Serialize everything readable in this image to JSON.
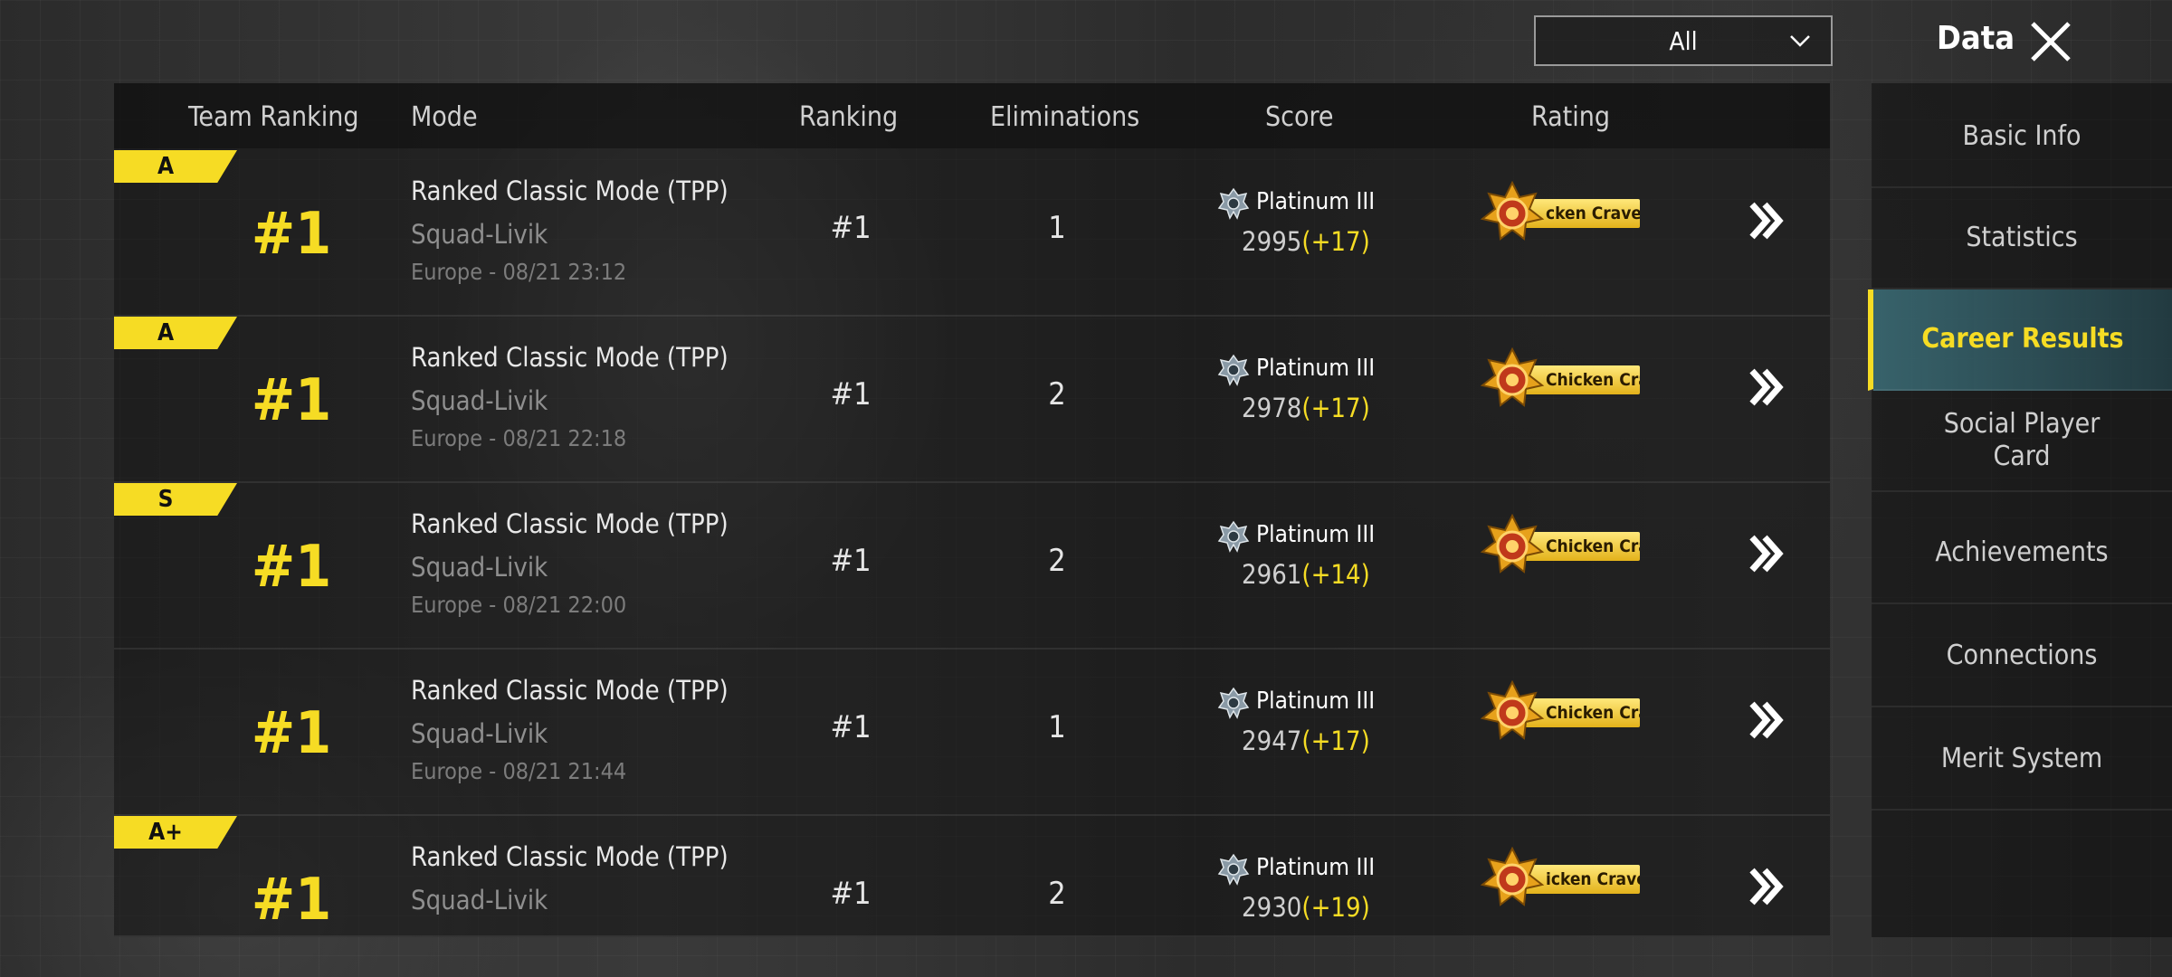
{
  "header": {
    "filter_value": "All",
    "title": "Data",
    "close_icon": "close-icon"
  },
  "columns": {
    "team_ranking": "Team Ranking",
    "mode": "Mode",
    "ranking": "Ranking",
    "eliminations": "Eliminations",
    "score": "Score",
    "rating": "Rating"
  },
  "rows": [
    {
      "grade": "A",
      "team_rank": "#1",
      "mode": "Ranked Classic Mode (TPP)",
      "map": "Squad-Livik",
      "meta": "Europe - 08/21 23:12",
      "ranking": "#1",
      "eliminations": "1",
      "tier": "Platinum III",
      "score": "2995",
      "delta": "(+17)",
      "rating_title": "cken Craver"
    },
    {
      "grade": "A",
      "team_rank": "#1",
      "mode": "Ranked Classic Mode (TPP)",
      "map": "Squad-Livik",
      "meta": "Europe - 08/21 22:18",
      "ranking": "#1",
      "eliminations": "2",
      "tier": "Platinum III",
      "score": "2978",
      "delta": "(+17)",
      "rating_title": "Chicken Crav"
    },
    {
      "grade": "S",
      "team_rank": "#1",
      "mode": "Ranked Classic Mode (TPP)",
      "map": "Squad-Livik",
      "meta": "Europe - 08/21 22:00",
      "ranking": "#1",
      "eliminations": "2",
      "tier": "Platinum III",
      "score": "2961",
      "delta": "(+14)",
      "rating_title": "Chicken Crav"
    },
    {
      "grade": "",
      "team_rank": "#1",
      "mode": "Ranked Classic Mode (TPP)",
      "map": "Squad-Livik",
      "meta": "Europe - 08/21 21:44",
      "ranking": "#1",
      "eliminations": "1",
      "tier": "Platinum III",
      "score": "2947",
      "delta": "(+17)",
      "rating_title": "Chicken Crav"
    },
    {
      "grade": "A+",
      "team_rank": "#1",
      "mode": "Ranked Classic Mode (TPP)",
      "map": "Squad-Livik",
      "meta": "",
      "ranking": "#1",
      "eliminations": "2",
      "tier": "Platinum III",
      "score": "2930",
      "delta": "(+19)",
      "rating_title": "icken Craver"
    }
  ],
  "sidebar": {
    "items": [
      {
        "label": "Basic Info",
        "active": false
      },
      {
        "label": "Statistics",
        "active": false
      },
      {
        "label": "Career Results",
        "active": true
      },
      {
        "label": "Social Player Card",
        "active": false
      },
      {
        "label": "Achievements",
        "active": false
      },
      {
        "label": "Connections",
        "active": false
      },
      {
        "label": "Merit System",
        "active": false
      }
    ]
  },
  "colors": {
    "accent": "#f6dc24",
    "active_tab": "#3c6e78"
  }
}
